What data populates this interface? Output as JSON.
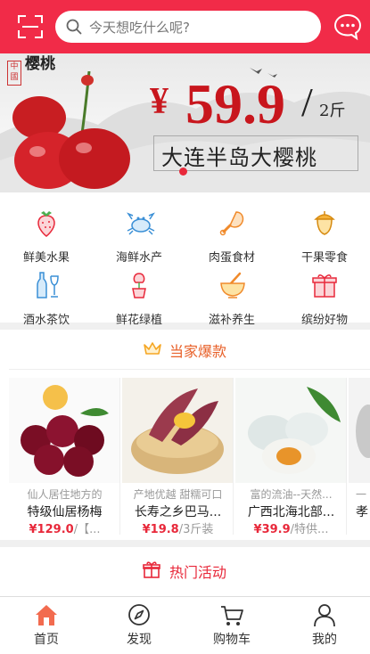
{
  "header": {
    "search_placeholder": "今天想吃什么呢?",
    "accent": "#f12b48"
  },
  "banner": {
    "seal_text": "中國",
    "brush_text": "樱桃",
    "price_symbol": "¥",
    "price_value": "59.9",
    "slash": "/",
    "unit": "2斤",
    "tagline": "大连半岛大樱桃"
  },
  "categories": [
    {
      "label": "鲜美水果",
      "icon": "strawberry-icon"
    },
    {
      "label": "海鲜水产",
      "icon": "crab-icon"
    },
    {
      "label": "肉蛋食材",
      "icon": "drumstick-icon"
    },
    {
      "label": "干果零食",
      "icon": "acorn-icon"
    },
    {
      "label": "酒水茶饮",
      "icon": "wine-bottle-icon"
    },
    {
      "label": "鲜花绿植",
      "icon": "flower-pot-icon"
    },
    {
      "label": "滋补养生",
      "icon": "mortar-icon"
    },
    {
      "label": "缤纷好物",
      "icon": "gift-box-icon"
    }
  ],
  "hot": {
    "title": "当家爆款",
    "items": [
      {
        "subtitle": "仙人居住地方的",
        "name": "特级仙居杨梅",
        "price": "¥129.0",
        "suffix": "/【..."
      },
      {
        "subtitle": "产地优越 甜糯可口",
        "name": "长寿之乡巴马...",
        "price": "¥19.8",
        "suffix": "/3斤装"
      },
      {
        "subtitle": "富的流油--天然...",
        "name": "广西北海北部...",
        "price": "¥39.9",
        "suffix": "/特供..."
      },
      {
        "subtitle": "一",
        "name": "孝",
        "price": "",
        "suffix": ""
      }
    ]
  },
  "activity": {
    "title": "热门活动"
  },
  "tabbar": [
    {
      "label": "首页",
      "icon": "home-icon"
    },
    {
      "label": "发现",
      "icon": "compass-icon"
    },
    {
      "label": "购物车",
      "icon": "cart-icon"
    },
    {
      "label": "我的",
      "icon": "user-icon"
    }
  ]
}
